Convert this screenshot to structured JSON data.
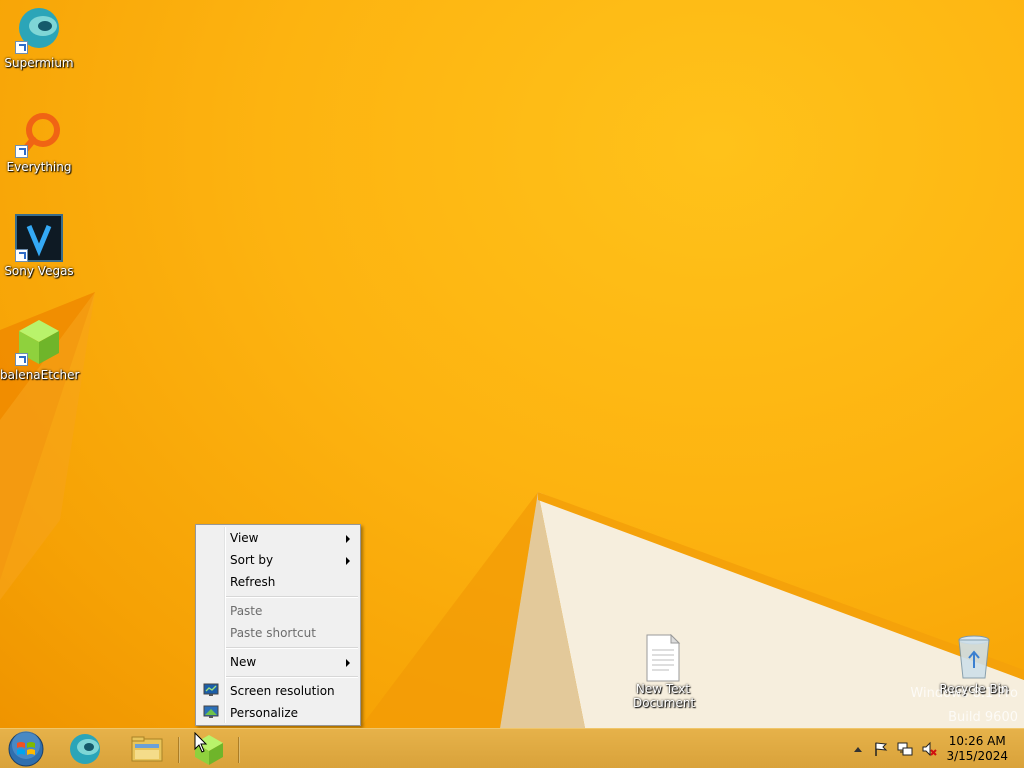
{
  "desktop": {
    "icons": [
      {
        "label": "Supermium"
      },
      {
        "label": "Everything"
      },
      {
        "label": "Sony Vegas"
      },
      {
        "label": "balenaEtcher"
      },
      {
        "label": "New Text Document"
      },
      {
        "label": "Recycle Bin"
      }
    ],
    "watermark": {
      "line1": "Windows 8.1 Pro",
      "line2": "Build 9600"
    }
  },
  "context_menu": {
    "items": [
      {
        "label": "View"
      },
      {
        "label": "Sort by"
      },
      {
        "label": "Refresh"
      },
      {
        "label": "Paste"
      },
      {
        "label": "Paste shortcut"
      },
      {
        "label": "New"
      },
      {
        "label": "Screen resolution"
      },
      {
        "label": "Personalize"
      }
    ]
  },
  "taskbar": {
    "clock": {
      "time": "10:26 AM",
      "date": "3/15/2024"
    }
  },
  "colors": {
    "wallpaper": "#fdb310",
    "taskbar": "#dfaa41",
    "menu_bg": "#f0f0f0"
  }
}
